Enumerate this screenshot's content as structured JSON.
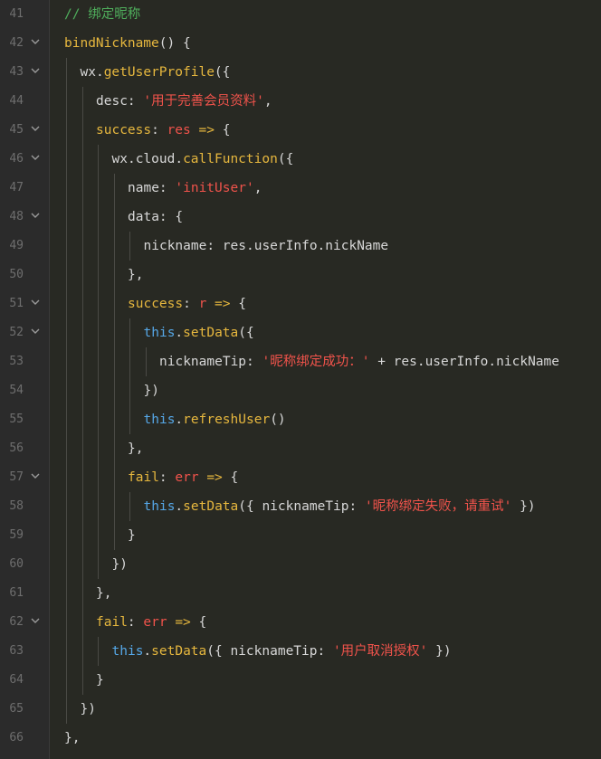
{
  "editor": {
    "colors": {
      "background": "#282923",
      "line_number": "#6e6e6e",
      "comment": "#4fae5c",
      "function": "#e6b73e",
      "string": "#f0534b",
      "this": "#56a8e8",
      "plain": "#d7d7d7"
    },
    "lines": [
      {
        "num": "41",
        "fold": false,
        "indent": 0,
        "tokens": [
          [
            "c-comment",
            "// 绑定昵称"
          ]
        ]
      },
      {
        "num": "42",
        "fold": true,
        "indent": 0,
        "tokens": [
          [
            "c-fn",
            "bindNickname"
          ],
          [
            "c-plain",
            "() {"
          ]
        ]
      },
      {
        "num": "43",
        "fold": true,
        "indent": 1,
        "tokens": [
          [
            "c-plain",
            "wx."
          ],
          [
            "c-fn",
            "getUserProfile"
          ],
          [
            "c-plain",
            "({"
          ]
        ]
      },
      {
        "num": "44",
        "fold": false,
        "indent": 2,
        "tokens": [
          [
            "c-plain",
            "desc: "
          ],
          [
            "c-str",
            "'用于完善会员资料'"
          ],
          [
            "c-plain",
            ","
          ]
        ]
      },
      {
        "num": "45",
        "fold": true,
        "indent": 2,
        "tokens": [
          [
            "c-key",
            "success"
          ],
          [
            "c-plain",
            ": "
          ],
          [
            "c-param",
            "res"
          ],
          [
            "c-key",
            " =>"
          ],
          [
            "c-plain",
            " {"
          ]
        ]
      },
      {
        "num": "46",
        "fold": true,
        "indent": 3,
        "tokens": [
          [
            "c-plain",
            "wx.cloud."
          ],
          [
            "c-fn",
            "callFunction"
          ],
          [
            "c-plain",
            "({"
          ]
        ]
      },
      {
        "num": "47",
        "fold": false,
        "indent": 4,
        "tokens": [
          [
            "c-plain",
            "name: "
          ],
          [
            "c-str",
            "'initUser'"
          ],
          [
            "c-plain",
            ","
          ]
        ]
      },
      {
        "num": "48",
        "fold": true,
        "indent": 4,
        "tokens": [
          [
            "c-plain",
            "data: {"
          ]
        ]
      },
      {
        "num": "49",
        "fold": false,
        "indent": 5,
        "tokens": [
          [
            "c-plain",
            "nickname: res.userInfo.nickName"
          ]
        ]
      },
      {
        "num": "50",
        "fold": false,
        "indent": 4,
        "tokens": [
          [
            "c-plain",
            "},"
          ]
        ]
      },
      {
        "num": "51",
        "fold": true,
        "indent": 4,
        "tokens": [
          [
            "c-key",
            "success"
          ],
          [
            "c-plain",
            ": "
          ],
          [
            "c-param",
            "r"
          ],
          [
            "c-key",
            " =>"
          ],
          [
            "c-plain",
            " {"
          ]
        ]
      },
      {
        "num": "52",
        "fold": true,
        "indent": 5,
        "tokens": [
          [
            "c-this",
            "this"
          ],
          [
            "c-plain",
            "."
          ],
          [
            "c-fn",
            "setData"
          ],
          [
            "c-plain",
            "({"
          ]
        ]
      },
      {
        "num": "53",
        "fold": false,
        "indent": 6,
        "tokens": [
          [
            "c-plain",
            "nicknameTip: "
          ],
          [
            "c-str",
            "'昵称绑定成功：'"
          ],
          [
            "c-plain",
            " + res.userInfo.nickName"
          ]
        ]
      },
      {
        "num": "54",
        "fold": false,
        "indent": 5,
        "tokens": [
          [
            "c-plain",
            "})"
          ]
        ]
      },
      {
        "num": "55",
        "fold": false,
        "indent": 5,
        "tokens": [
          [
            "c-this",
            "this"
          ],
          [
            "c-plain",
            "."
          ],
          [
            "c-fn",
            "refreshUser"
          ],
          [
            "c-plain",
            "()"
          ]
        ]
      },
      {
        "num": "56",
        "fold": false,
        "indent": 4,
        "tokens": [
          [
            "c-plain",
            "},"
          ]
        ]
      },
      {
        "num": "57",
        "fold": true,
        "indent": 4,
        "tokens": [
          [
            "c-key",
            "fail"
          ],
          [
            "c-plain",
            ": "
          ],
          [
            "c-param",
            "err"
          ],
          [
            "c-key",
            " =>"
          ],
          [
            "c-plain",
            " {"
          ]
        ]
      },
      {
        "num": "58",
        "fold": false,
        "indent": 5,
        "tokens": [
          [
            "c-this",
            "this"
          ],
          [
            "c-plain",
            "."
          ],
          [
            "c-fn",
            "setData"
          ],
          [
            "c-plain",
            "({ nicknameTip: "
          ],
          [
            "c-str",
            "'昵称绑定失败，请重试'"
          ],
          [
            "c-plain",
            " })"
          ]
        ]
      },
      {
        "num": "59",
        "fold": false,
        "indent": 4,
        "tokens": [
          [
            "c-plain",
            "}"
          ]
        ]
      },
      {
        "num": "60",
        "fold": false,
        "indent": 3,
        "tokens": [
          [
            "c-plain",
            "})"
          ]
        ]
      },
      {
        "num": "61",
        "fold": false,
        "indent": 2,
        "tokens": [
          [
            "c-plain",
            "},"
          ]
        ]
      },
      {
        "num": "62",
        "fold": true,
        "indent": 2,
        "tokens": [
          [
            "c-key",
            "fail"
          ],
          [
            "c-plain",
            ": "
          ],
          [
            "c-param",
            "err"
          ],
          [
            "c-key",
            " =>"
          ],
          [
            "c-plain",
            " {"
          ]
        ]
      },
      {
        "num": "63",
        "fold": false,
        "indent": 3,
        "tokens": [
          [
            "c-this",
            "this"
          ],
          [
            "c-plain",
            "."
          ],
          [
            "c-fn",
            "setData"
          ],
          [
            "c-plain",
            "({ nicknameTip: "
          ],
          [
            "c-str",
            "'用户取消授权'"
          ],
          [
            "c-plain",
            " })"
          ]
        ]
      },
      {
        "num": "64",
        "fold": false,
        "indent": 2,
        "tokens": [
          [
            "c-plain",
            "}"
          ]
        ]
      },
      {
        "num": "65",
        "fold": false,
        "indent": 1,
        "tokens": [
          [
            "c-plain",
            "})"
          ]
        ]
      },
      {
        "num": "66",
        "fold": false,
        "indent": 0,
        "tokens": [
          [
            "c-plain",
            "},"
          ]
        ]
      }
    ]
  }
}
